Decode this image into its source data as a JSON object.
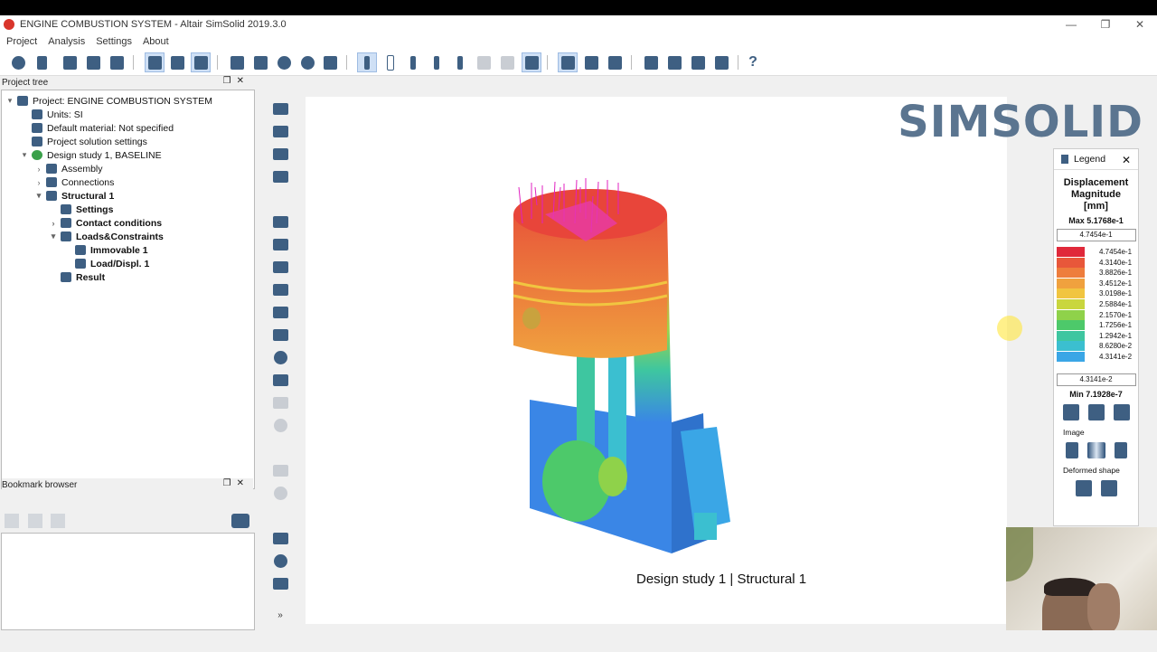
{
  "window": {
    "title": "ENGINE COMBUSTION SYSTEM - Altair SimSolid 2019.3.0",
    "min": "—",
    "restore": "❐",
    "close": "✕"
  },
  "menu": [
    "Project",
    "Analysis",
    "Settings",
    "About"
  ],
  "project_tree": {
    "header": "Project tree",
    "items": [
      {
        "label": "Project: ENGINE COMBUSTION SYSTEM",
        "arrow": "▾",
        "indent": 0,
        "bold": false,
        "icon": "gear-icon"
      },
      {
        "label": "Units: SI",
        "arrow": "",
        "indent": 1,
        "bold": false,
        "icon": "ruler-icon"
      },
      {
        "label": "Default material: Not specified",
        "arrow": "",
        "indent": 1,
        "bold": false,
        "icon": "material-icon"
      },
      {
        "label": "Project solution settings",
        "arrow": "",
        "indent": 1,
        "bold": false,
        "icon": "settings-icon"
      },
      {
        "label": "Design study 1, BASELINE",
        "arrow": "▾",
        "indent": 1,
        "bold": false,
        "icon": "design-study-icon"
      },
      {
        "label": "Assembly",
        "arrow": "›",
        "indent": 2,
        "bold": false,
        "icon": "assembly-icon"
      },
      {
        "label": "Connections",
        "arrow": "›",
        "indent": 2,
        "bold": false,
        "icon": "connections-icon"
      },
      {
        "label": "Structural  1",
        "arrow": "▾",
        "indent": 2,
        "bold": true,
        "icon": "structural-icon"
      },
      {
        "label": "Settings",
        "arrow": "",
        "indent": 3,
        "bold": true,
        "icon": "settings-icon"
      },
      {
        "label": "Contact conditions",
        "arrow": "›",
        "indent": 3,
        "bold": true,
        "icon": "contact-icon"
      },
      {
        "label": "Loads&Constraints",
        "arrow": "▾",
        "indent": 3,
        "bold": true,
        "icon": "loads-icon"
      },
      {
        "label": "Immovable 1",
        "arrow": "",
        "indent": 4,
        "bold": true,
        "icon": "immovable-icon"
      },
      {
        "label": "Load/Displ. 1",
        "arrow": "",
        "indent": 4,
        "bold": true,
        "icon": "load-icon"
      },
      {
        "label": "Result",
        "arrow": "",
        "indent": 3,
        "bold": true,
        "icon": "result-icon"
      }
    ]
  },
  "bookmark_browser": {
    "header": "Bookmark browser"
  },
  "viewport": {
    "logo": "SIMSOLID",
    "caption": "Design study 1 | Structural  1"
  },
  "legend": {
    "header": "Legend",
    "title_lines": [
      "Displacement",
      "Magnitude",
      "[mm]"
    ],
    "max_label": "Max  5.1768e-1",
    "top_value": "4.7454e-1",
    "bottom_value": "4.3141e-2",
    "min_label": "Min  7.1928e-7",
    "section_image": "Image",
    "section_deformed": "Deformed shape",
    "scale": [
      {
        "label": "4.7454e-1",
        "color": "#e0283a"
      },
      {
        "label": "4.3140e-1",
        "color": "#e8573a"
      },
      {
        "label": "3.8826e-1",
        "color": "#ee7d3c"
      },
      {
        "label": "3.4512e-1",
        "color": "#f0a13e"
      },
      {
        "label": "3.0198e-1",
        "color": "#f1c540"
      },
      {
        "label": "2.5884e-1",
        "color": "#c9d63e"
      },
      {
        "label": "2.1570e-1",
        "color": "#8fd24a"
      },
      {
        "label": "1.7256e-1",
        "color": "#4dc96a"
      },
      {
        "label": "1.2942e-1",
        "color": "#3ec6a0"
      },
      {
        "label": "8.6280e-2",
        "color": "#3bbfd0"
      },
      {
        "label": "4.3141e-2",
        "color": "#3aa6e6"
      }
    ]
  }
}
